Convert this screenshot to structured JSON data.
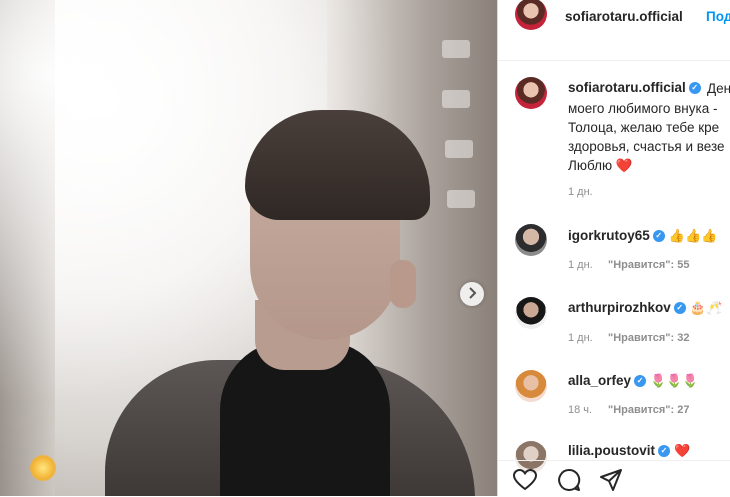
{
  "post": {
    "author": "sofiarotaru.official",
    "follow_label": "Под",
    "caption_lines": [
      "Ден",
      "моего любимого внука -",
      "Толоца, желаю тебе кре",
      "здоровья, счастья и везе",
      "Люблю ❤️"
    ],
    "caption_time": "1 дн."
  },
  "comments": [
    {
      "user": "igorkrutoy65",
      "verified": true,
      "text": "👍👍👍",
      "time": "1 дн.",
      "likes_label": "\"Нравится\": 55"
    },
    {
      "user": "arthurpirozhkov",
      "verified": true,
      "text": "🎂🥂",
      "time": "1 дн.",
      "likes_label": "\"Нравится\": 32"
    },
    {
      "user": "alla_orfey",
      "verified": true,
      "text": "🌷🌷🌷",
      "time": "18 ч.",
      "likes_label": "\"Нравится\": 27"
    },
    {
      "user": "lilia.poustovit",
      "verified": true,
      "text": "❤️"
    }
  ],
  "icons": {
    "next": "chevron-right-icon",
    "like": "heart-icon",
    "comment": "comment-icon",
    "share": "paper-plane-icon"
  },
  "colors": {
    "follow": "#0095f6",
    "verified": "#3897f0",
    "muted": "#8e8e8e"
  }
}
